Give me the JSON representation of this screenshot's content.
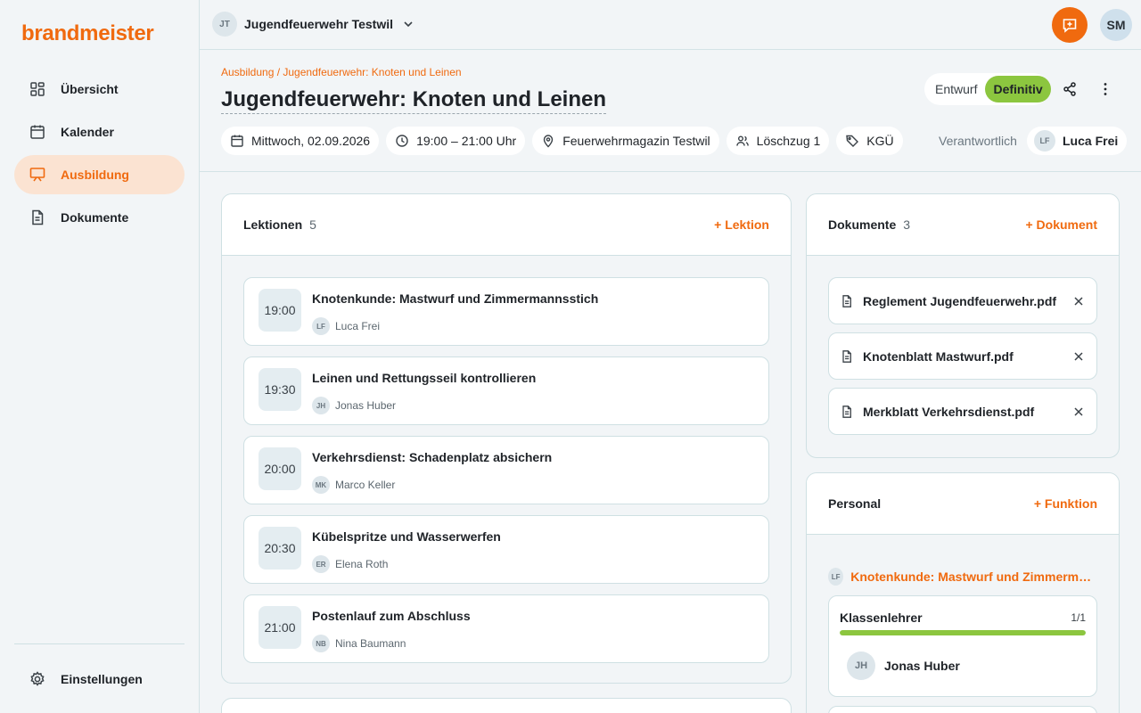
{
  "app": {
    "logo": "brandmeister"
  },
  "sidebar": {
    "items": [
      {
        "label": "Übersicht",
        "icon": "grid-icon"
      },
      {
        "label": "Kalender",
        "icon": "calendar-icon"
      },
      {
        "label": "Ausbildung",
        "icon": "presentation-icon",
        "active": true
      },
      {
        "label": "Dokumente",
        "icon": "document-icon"
      }
    ],
    "settings_label": "Einstellungen"
  },
  "topbar": {
    "org_initials": "JT",
    "org_name": "Jugendfeuerwehr Testwil",
    "user_initials": "SM"
  },
  "header": {
    "breadcrumb": "Ausbildung / Jugendfeuerwehr: Knoten und Leinen",
    "title": "Jugendfeuerwehr: Knoten und Leinen",
    "status_options": [
      "Entwurf",
      "Definitiv"
    ],
    "status_selected": "Definitiv",
    "date": "Mittwoch, 02.09.2026",
    "time": "19:00 – 21:00 Uhr",
    "location": "Feuerwehrmagazin Testwil",
    "group": "Löschzug 1",
    "tag": "KGÜ",
    "responsible_label": "Verantwortlich",
    "responsible_initials": "LF",
    "responsible_name": "Luca Frei"
  },
  "lessons": {
    "title": "Lektionen",
    "count": "5",
    "add_label": "+ Lektion",
    "items": [
      {
        "time": "19:00",
        "title": "Knotenkunde: Mastwurf und Zimmermannsstich",
        "initials": "LF",
        "person": "Luca Frei"
      },
      {
        "time": "19:30",
        "title": "Leinen und Rettungsseil kontrollieren",
        "initials": "JH",
        "person": "Jonas Huber"
      },
      {
        "time": "20:00",
        "title": "Verkehrsdienst: Schadenplatz absichern",
        "initials": "MK",
        "person": "Marco Keller"
      },
      {
        "time": "20:30",
        "title": "Kübelspritze und Wasserwerfen",
        "initials": "ER",
        "person": "Elena Roth"
      },
      {
        "time": "21:00",
        "title": "Postenlauf zum Abschluss",
        "initials": "NB",
        "person": "Nina Baumann"
      }
    ]
  },
  "documents": {
    "title": "Dokumente",
    "count": "3",
    "add_label": "+ Dokument",
    "items": [
      {
        "name": "Reglement Jugendfeuerwehr.pdf"
      },
      {
        "name": "Knotenblatt Mastwurf.pdf"
      },
      {
        "name": "Merkblatt Verkehrsdienst.pdf"
      }
    ]
  },
  "personal": {
    "title": "Personal",
    "add_label": "+ Funktion",
    "lesson_initials": "LF",
    "lesson_title": "Knotenkunde: Mastwurf und Zimmermannsstich",
    "role": {
      "name": "Klassenlehrer",
      "count": "1/1",
      "fill": 1.0,
      "person_initials": "JH",
      "person_name": "Jonas Huber"
    }
  },
  "colors": {
    "accent": "#f06a0f",
    "success": "#8cc63f",
    "border": "#cfe0e3",
    "background": "#f2f5f7"
  }
}
